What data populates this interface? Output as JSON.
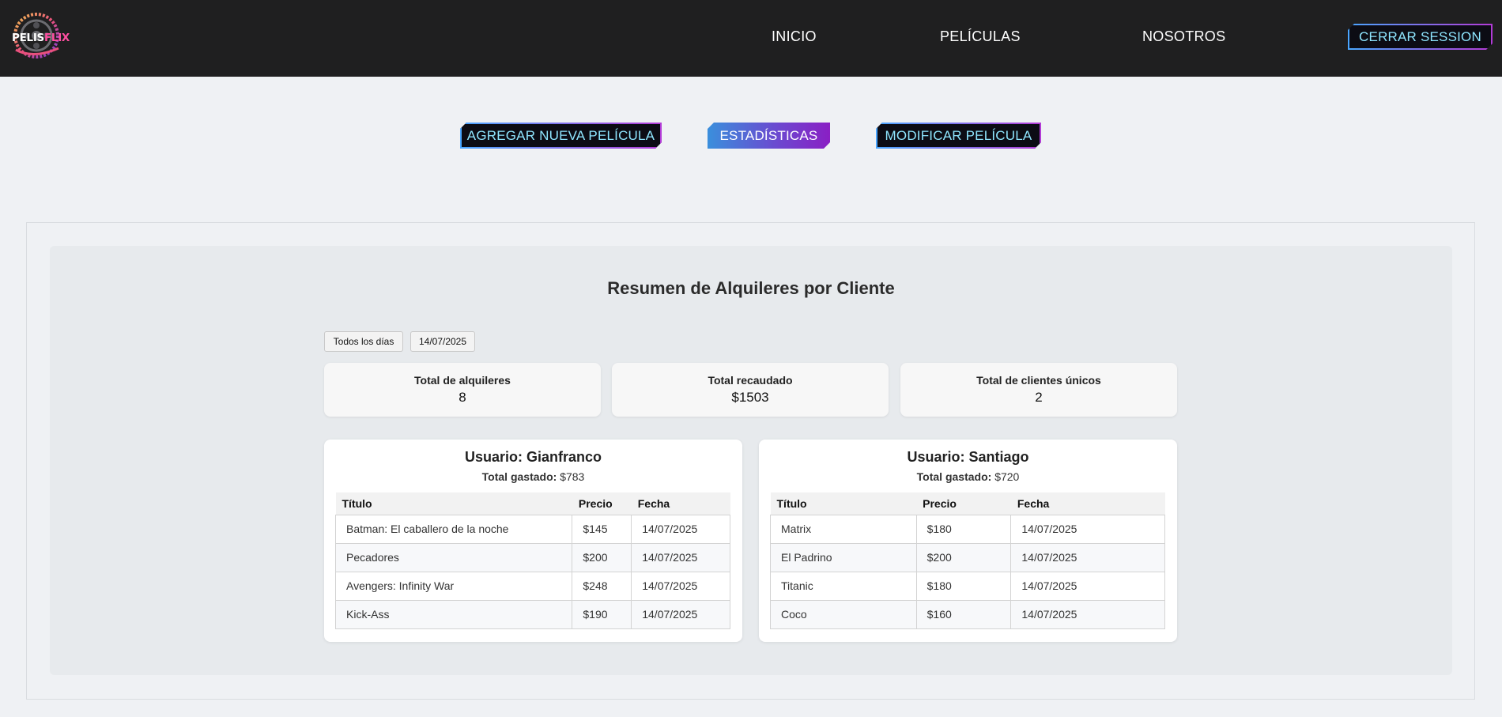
{
  "brand": {
    "part1": "PELIS",
    "part2": "FLIX",
    "accent": "#ff4fa0"
  },
  "nav": {
    "links": [
      "INICIO",
      "PELÍCULAS",
      "NOSOTROS"
    ],
    "logout": "CERRAR SESSION"
  },
  "admin_tabs": {
    "add": "AGREGAR NUEVA PELÍCULA",
    "stats": "ESTADÍSTICAS",
    "modify": "MODIFICAR PELÍCULA",
    "active": "ESTADÍSTICAS"
  },
  "summary": {
    "title": "Resumen de Alquileres por Cliente",
    "filters": [
      "Todos los días",
      "14/07/2025"
    ],
    "stats": [
      {
        "label": "Total de alquileres",
        "value": "8"
      },
      {
        "label": "Total recaudado",
        "value": "$1503"
      },
      {
        "label": "Total de clientes únicos",
        "value": "2"
      }
    ],
    "columns": [
      "Título",
      "Precio",
      "Fecha"
    ],
    "total_label": "Total gastado:",
    "users": [
      {
        "name": "Usuario: Gianfranco",
        "total": "$783",
        "rentals": [
          {
            "title": "Batman: El caballero de la noche",
            "price": "$145",
            "date": "14/07/2025"
          },
          {
            "title": "Pecadores",
            "price": "$200",
            "date": "14/07/2025"
          },
          {
            "title": "Avengers: Infinity War",
            "price": "$248",
            "date": "14/07/2025"
          },
          {
            "title": "Kick-Ass",
            "price": "$190",
            "date": "14/07/2025"
          }
        ]
      },
      {
        "name": "Usuario: Santiago",
        "total": "$720",
        "rentals": [
          {
            "title": "Matrix",
            "price": "$180",
            "date": "14/07/2025"
          },
          {
            "title": "El Padrino",
            "price": "$200",
            "date": "14/07/2025"
          },
          {
            "title": "Titanic",
            "price": "$180",
            "date": "14/07/2025"
          },
          {
            "title": "Coco",
            "price": "$160",
            "date": "14/07/2025"
          }
        ]
      }
    ]
  }
}
